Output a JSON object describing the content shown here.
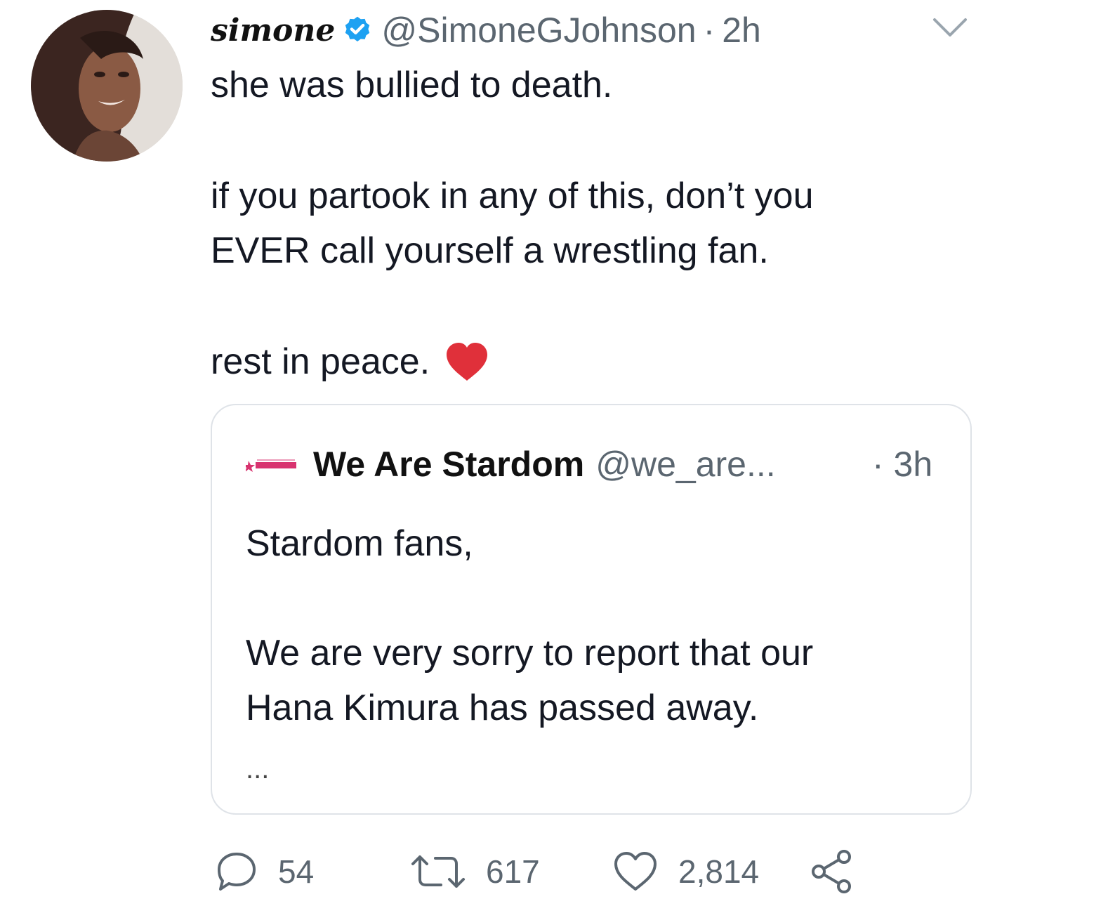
{
  "tweet": {
    "display_name": "simone",
    "handle": "@SimoneGJohnson",
    "separator": "·",
    "time": "2h",
    "lines": [
      "she was bullied to death.",
      "if you partook in any of this, don’t you",
      "EVER call yourself a wrestling fan.",
      "rest in peace."
    ],
    "emoji": "red-heart",
    "verified": true
  },
  "quoted_tweet": {
    "name": "We Are Stardom",
    "handle": "@we_are...",
    "time": "· 3h",
    "lines": [
      "Stardom fans,",
      "We are very sorry to report that our",
      "Hana Kimura has passed away.",
      "..."
    ]
  },
  "actions": {
    "replies": "54",
    "retweets": "617",
    "likes": "2,814"
  },
  "colors": {
    "text": "#141823",
    "secondary": "#5b6670",
    "verified_blue": "#1da1f2",
    "heart_red": "#e0303a",
    "border": "#dfe3e8"
  },
  "icons": {
    "verified": "verified-badge-icon",
    "caret": "chevron-down-icon",
    "reply": "reply-icon",
    "retweet": "retweet-icon",
    "like": "like-heart-icon",
    "share": "share-icon"
  }
}
